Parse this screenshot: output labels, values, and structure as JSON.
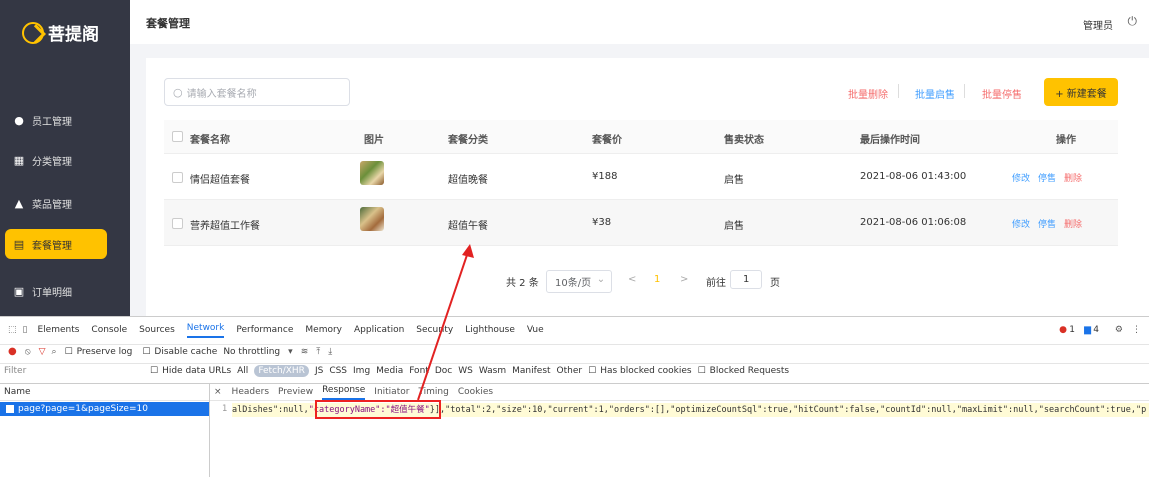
{
  "sidebar": {
    "logo": "菩提阁",
    "items": [
      {
        "label": "员工管理",
        "icon": "info-circle-icon"
      },
      {
        "label": "分类管理",
        "icon": "grid-icon"
      },
      {
        "label": "菜品管理",
        "icon": "triangle-icon"
      },
      {
        "label": "套餐管理",
        "icon": "package-icon",
        "active": true
      },
      {
        "label": "订单明细",
        "icon": "receipt-icon"
      }
    ]
  },
  "header": {
    "title": "套餐管理",
    "admin": "管理员"
  },
  "toolbar": {
    "search_placeholder": "请输入套餐名称",
    "batch_delete": "批量删除",
    "batch_enable": "批量启售",
    "batch_disable": "批量停售",
    "new_button": "+ 新建套餐"
  },
  "table": {
    "headers": [
      "套餐名称",
      "图片",
      "套餐分类",
      "套餐价",
      "售卖状态",
      "最后操作时间",
      "操作"
    ],
    "rows": [
      {
        "name": "情侣超值套餐",
        "category": "超值晚餐",
        "price": "¥188",
        "status": "启售",
        "time": "2021-08-06 01:43:00"
      },
      {
        "name": "营养超值工作餐",
        "category": "超值午餐",
        "price": "¥38",
        "status": "启售",
        "time": "2021-08-06 01:06:08"
      }
    ],
    "ops": {
      "edit": "修改",
      "disable": "停售",
      "delete": "删除"
    }
  },
  "pagination": {
    "total": "共 2 条",
    "page_size": "10条/页",
    "current": "1",
    "goto_label": "前往",
    "goto_value": "1",
    "page_unit": "页"
  },
  "devtools": {
    "tabs": [
      "Elements",
      "Console",
      "Sources",
      "Network",
      "Performance",
      "Memory",
      "Application",
      "Security",
      "Lighthouse",
      "Vue"
    ],
    "active_tab": "Network",
    "badges": {
      "errors": "1",
      "messages": "4"
    },
    "toolbar": {
      "preserve_log": "Preserve log",
      "disable_cache": "Disable cache",
      "throttle": "No throttling"
    },
    "filter": {
      "placeholder": "Filter",
      "hide_data_urls": "Hide data URLs",
      "types": [
        "All",
        "Fetch/XHR",
        "JS",
        "CSS",
        "Img",
        "Media",
        "Font",
        "Doc",
        "WS",
        "Wasm",
        "Manifest",
        "Other"
      ],
      "active_type": "Fetch/XHR",
      "blocked_cookies": "Has blocked cookies",
      "blocked_requests": "Blocked Requests"
    },
    "name_header": "Name",
    "request": "page?page=1&pageSize=10",
    "detail_tabs": [
      "Headers",
      "Preview",
      "Response",
      "Initiator",
      "Timing",
      "Cookies"
    ],
    "active_detail": "Response",
    "line_number": "1",
    "response_pre": "alDishes\":null,",
    "response_highlight": "\"categoryName\":\"超值午餐\"",
    "response_post": "}],\"total\":2,\"size\":10,\"current\":1,\"orders\":[],\"optimizeCountSql\":true,\"hitCount\":false,\"countId\":null,\"maxLimit\":null,\"searchCount\":true,\"p"
  },
  "colors": {
    "sidebar": "#343744",
    "accent": "#ffc200",
    "danger": "#f56c6c",
    "link": "#419eff",
    "annotation": "#e22222"
  }
}
